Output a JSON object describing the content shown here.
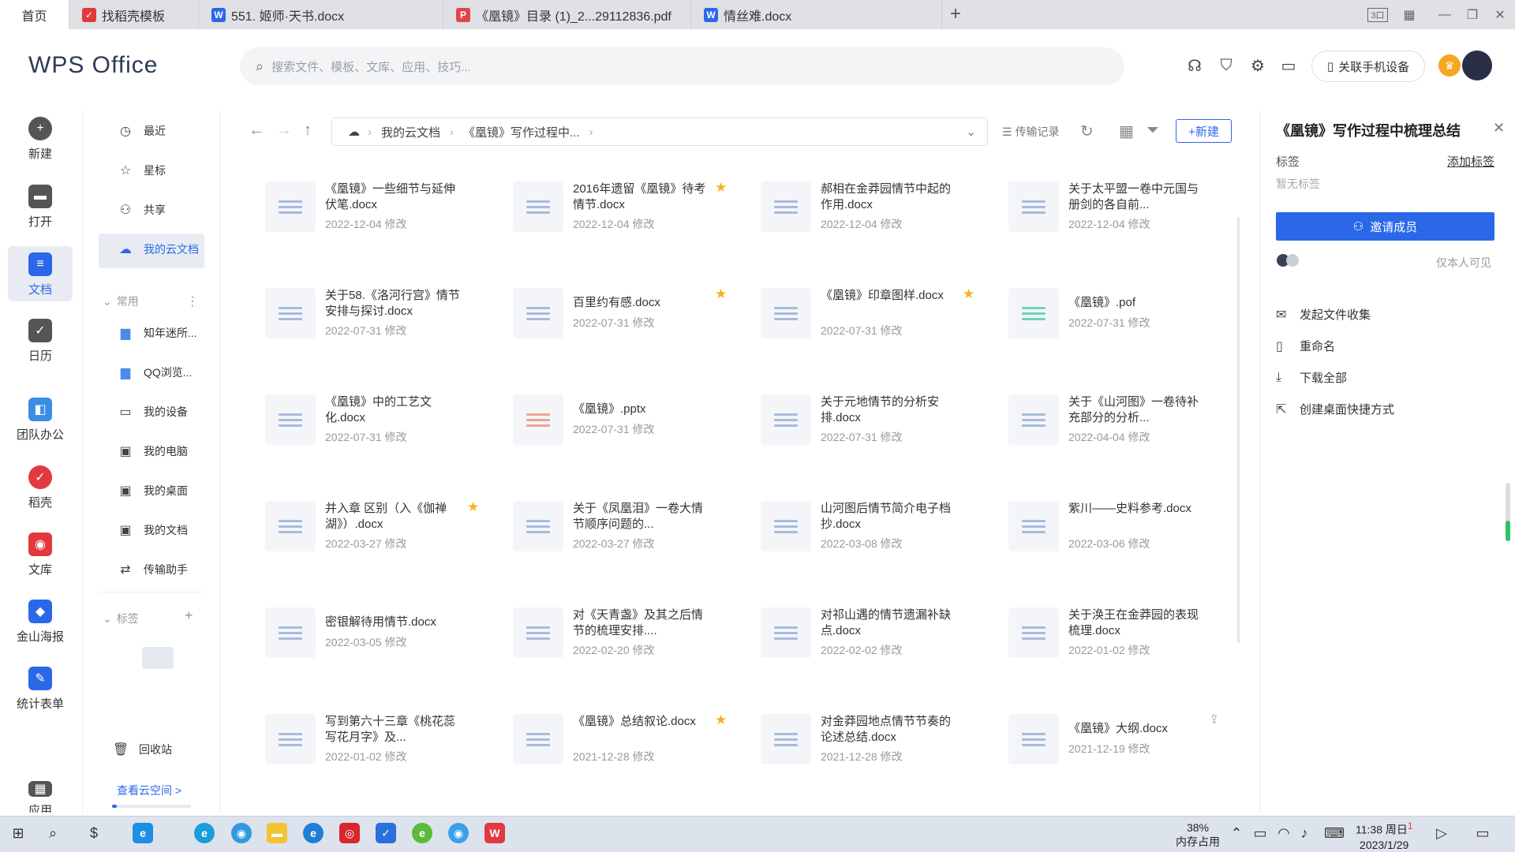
{
  "tabs": [
    {
      "label": "首页",
      "icon": "home",
      "color": "#ffffff"
    },
    {
      "label": "找稻壳模板",
      "icon": "docer-icon",
      "color": "#e03a3e"
    },
    {
      "label": "551. 姬师·天书.docx",
      "icon": "word-icon",
      "color": "#2b68e8"
    },
    {
      "label": "《凰镜》目录 (1)_2...29112836.pdf",
      "icon": "pdf-icon",
      "color": "#e0454a"
    },
    {
      "label": "情丝难.docx",
      "icon": "word-icon",
      "color": "#2b68e8"
    }
  ],
  "new_tab": "+",
  "window_controls": {
    "layout_badge": "3口"
  },
  "header": {
    "logo": "WPS Office",
    "search_placeholder": "搜索文件、模板、文库、应用、技巧...",
    "phone_btn": "关联手机设备"
  },
  "rail": [
    "新建",
    "打开",
    "文档",
    "日历",
    "团队办公",
    "稻壳",
    "文库",
    "金山海报",
    "统计表单",
    "应用"
  ],
  "nav": {
    "items": [
      "最近",
      "星标",
      "共享",
      "我的云文档"
    ],
    "group_common": "常用",
    "common": [
      "知年迷所...",
      "QQ浏览...",
      "我的设备",
      "我的电脑",
      "我的桌面",
      "我的文档",
      "传输助手"
    ],
    "group_tags": "标签",
    "recycle": "回收站",
    "cloud_link": "查看云空间 >"
  },
  "path": {
    "root": "我的云文档",
    "folder": "《凰镜》写作过程中...",
    "history": "传输记录",
    "new_btn": "+新建"
  },
  "files": [
    {
      "name": "《凰镜》一些细节与延伸伏笔.docx",
      "date": "2022-12-04 修改",
      "star": false,
      "kind": "doc"
    },
    {
      "name": "2016年遗留《凰镜》待考情节.docx",
      "date": "2022-12-04 修改",
      "star": true,
      "kind": "doc"
    },
    {
      "name": "郝相在金莽园情节中起的作用.docx",
      "date": "2022-12-04 修改",
      "star": false,
      "kind": "doc"
    },
    {
      "name": "关于太平盟一卷中元国与册剑的各自前...",
      "date": "2022-12-04 修改",
      "star": false,
      "kind": "doc"
    },
    {
      "name": "关于58.《洛河行宫》情节安排与探讨.docx",
      "date": "2022-07-31 修改",
      "star": false,
      "kind": "doc"
    },
    {
      "name": "百里约有感.docx",
      "date": "2022-07-31 修改",
      "star": true,
      "kind": "doc"
    },
    {
      "name": "《凰镜》印章图样.docx",
      "date": "2022-07-31 修改",
      "star": true,
      "kind": "doc"
    },
    {
      "name": "《凰镜》.pof",
      "date": "2022-07-31 修改",
      "star": false,
      "kind": "pof"
    },
    {
      "name": "《凰镜》中的工艺文化.docx",
      "date": "2022-07-31 修改",
      "star": false,
      "kind": "doc"
    },
    {
      "name": "《凰镜》.pptx",
      "date": "2022-07-31 修改",
      "star": false,
      "kind": "ppt"
    },
    {
      "name": "关于元地情节的分析安排.docx",
      "date": "2022-07-31 修改",
      "star": false,
      "kind": "doc"
    },
    {
      "name": "关于《山河图》一卷待补充部分的分析...",
      "date": "2022-04-04 修改",
      "star": false,
      "kind": "doc"
    },
    {
      "name": "并入章 区别（入《伽禅湖》）.docx",
      "date": "2022-03-27 修改",
      "star": true,
      "kind": "doc"
    },
    {
      "name": "关于《凤凰泪》一卷大情节顺序问题的...",
      "date": "2022-03-27 修改",
      "star": false,
      "kind": "doc"
    },
    {
      "name": "山河图后情节简介电子档抄.docx",
      "date": "2022-03-08 修改",
      "star": false,
      "kind": "doc"
    },
    {
      "name": "紫川——史料参考.docx",
      "date": "2022-03-06 修改",
      "star": false,
      "kind": "doc"
    },
    {
      "name": "密银解待用情节.docx",
      "date": "2022-03-05 修改",
      "star": false,
      "kind": "doc"
    },
    {
      "name": "对《天青盏》及其之后情节的梳理安排....",
      "date": "2022-02-20 修改",
      "star": false,
      "kind": "doc"
    },
    {
      "name": "对祁山遇的情节遗漏补缺点.docx",
      "date": "2022-02-02 修改",
      "star": false,
      "kind": "doc"
    },
    {
      "name": "关于涣王在金莽园的表现梳理.docx",
      "date": "2022-01-02 修改",
      "star": false,
      "kind": "doc"
    },
    {
      "name": "写到第六十三章《桃花蕊写花月字》及...",
      "date": "2022-01-02 修改",
      "star": false,
      "kind": "doc"
    },
    {
      "name": "《凰镜》总结叙论.docx",
      "date": "2021-12-28 修改",
      "star": true,
      "kind": "doc"
    },
    {
      "name": "对金莽园地点情节节奏的论述总结.docx",
      "date": "2021-12-28 修改",
      "star": false,
      "kind": "doc"
    },
    {
      "name": "《凰镜》大纲.docx",
      "date": "2021-12-19 修改",
      "star": false,
      "kind": "doc"
    }
  ],
  "panel": {
    "title": "《凰镜》写作过程中梳理总结",
    "tags_label": "标签",
    "add_tag": "添加标签",
    "no_tag": "暂无标签",
    "invite": "邀请成员",
    "visibility": "仅本人可见",
    "actions": [
      "发起文件收集",
      "重命名",
      "下载全部",
      "创建桌面快捷方式"
    ]
  },
  "taskbar": {
    "memory": "38%",
    "memory_label": "内存占用",
    "time": "11:38 周日",
    "date": "2023/1/29",
    "badge": "1"
  },
  "colors": {
    "accent": "#2b68e8",
    "star": "#f6b21d"
  }
}
